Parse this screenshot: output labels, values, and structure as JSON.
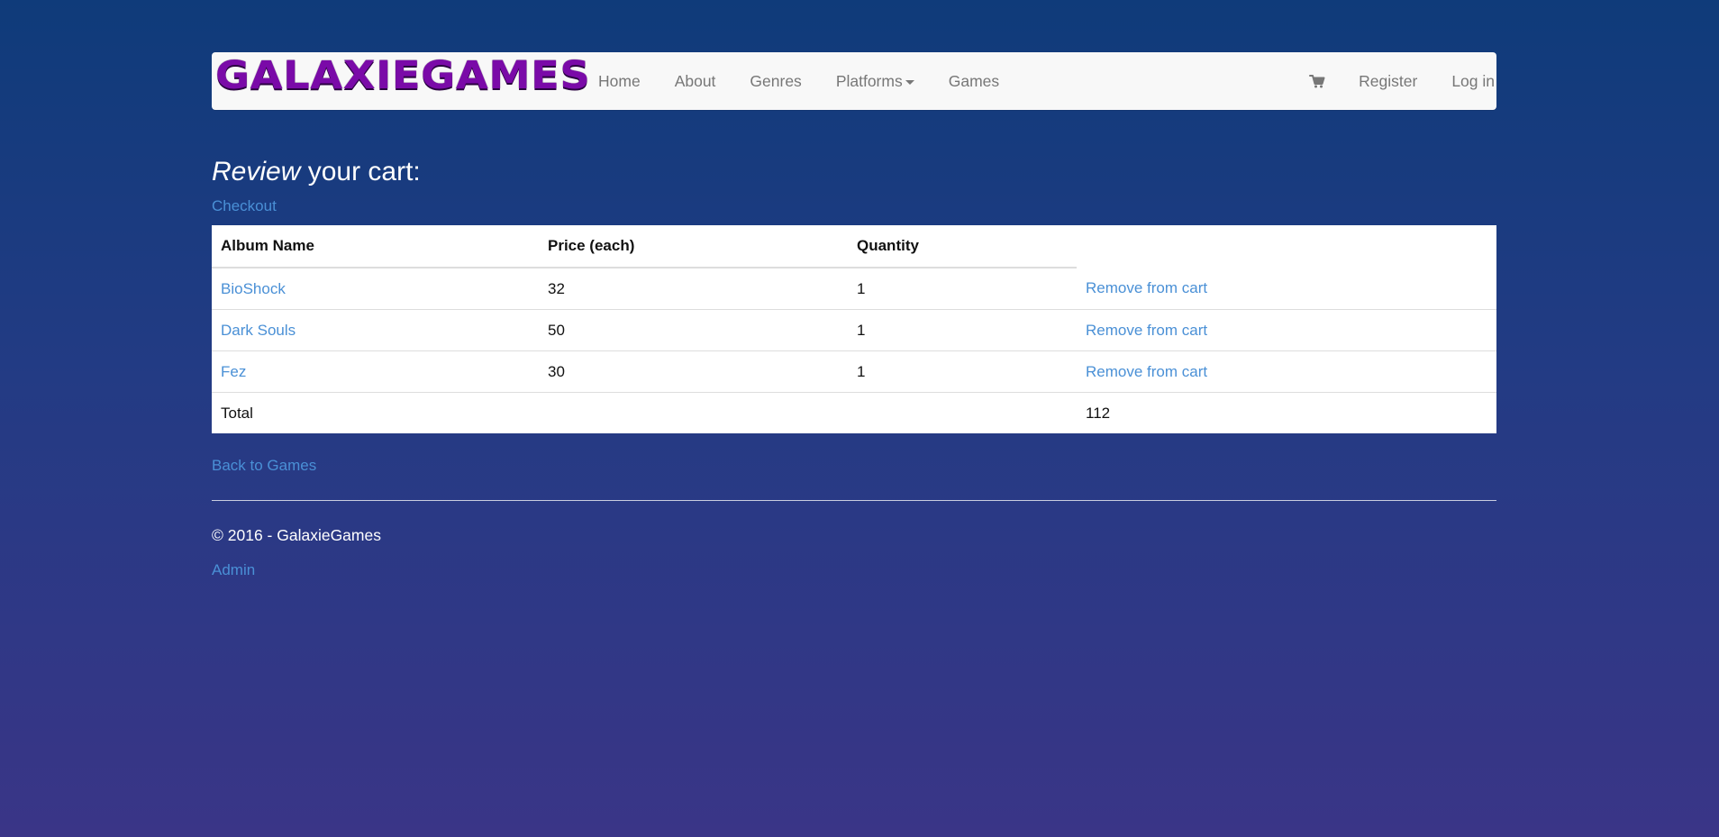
{
  "brand": {
    "name": "GALAXIEGAMES",
    "logo_color": "#7a0aa8"
  },
  "nav": {
    "left": [
      {
        "label": "Home"
      },
      {
        "label": "About"
      },
      {
        "label": "Genres"
      },
      {
        "label": "Platforms",
        "has_dropdown": true
      },
      {
        "label": "Games"
      }
    ],
    "right": {
      "cart_icon": "shopping-cart-icon",
      "register": "Register",
      "login": "Log in"
    }
  },
  "page": {
    "heading_em": "Review",
    "heading_rest": " your cart:",
    "checkout_label": "Checkout"
  },
  "table": {
    "headers": [
      "Album Name",
      "Price (each)",
      "Quantity",
      ""
    ],
    "rows": [
      {
        "name": "BioShock",
        "price": "32",
        "quantity": "1",
        "action": "Remove from cart"
      },
      {
        "name": "Dark Souls",
        "price": "50",
        "quantity": "1",
        "action": "Remove from cart"
      },
      {
        "name": "Fez",
        "price": "30",
        "quantity": "1",
        "action": "Remove from cart"
      }
    ],
    "total_label": "Total",
    "total_value": "112"
  },
  "footer": {
    "back_label": "Back to Games",
    "copyright": "© 2016 - GalaxieGames",
    "admin_label": "Admin"
  },
  "colors": {
    "link": "#4a90d6",
    "nav_text": "#777777",
    "navbar_bg": "#f8f8f8",
    "bg_top": "#0f3b7a",
    "bg_bottom": "#3a3587"
  }
}
